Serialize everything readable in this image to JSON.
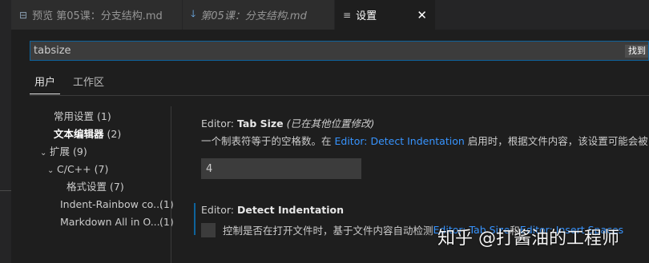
{
  "tabs": [
    {
      "label": "预览 第05课：分支结构.md",
      "icon": "preview-icon"
    },
    {
      "label": "第05课：分支结构.md",
      "icon": "markdown-down-arrow-icon"
    },
    {
      "label": "设置",
      "icon": "settings-lines-icon",
      "close": "✕"
    }
  ],
  "search": {
    "value": "tabsize",
    "badge": "找到"
  },
  "scopes": [
    {
      "label": "用户",
      "active": true
    },
    {
      "label": "工作区",
      "active": false
    }
  ],
  "toc": [
    {
      "label": "常用设置",
      "count": "(1)"
    },
    {
      "label": "文本编辑器",
      "count": "(2)"
    },
    {
      "label": "扩展",
      "count": "(9)"
    },
    {
      "label": "C/C++",
      "count": "(7)"
    },
    {
      "label": "格式设置",
      "count": "(7)"
    },
    {
      "label": "Indent-Rainbow co...",
      "count": "(1)"
    },
    {
      "label": "Markdown All in O...",
      "count": "(1)"
    }
  ],
  "settings": {
    "tab_size": {
      "category": "Editor: ",
      "name": "Tab Size",
      "modified_note": "(已在其他位置修改)",
      "desc_before": "一个制表符等于的空格数。在 ",
      "desc_link": "Editor: Detect Indentation",
      "desc_after": " 启用时，根据文件内容，该设置可能会被",
      "value": "4"
    },
    "detect_indentation": {
      "category": "Editor: ",
      "name": "Detect Indentation",
      "desc_before": "控制是否在打开文件时，基于文件内容自动检测 ",
      "desc_link1": "Editor: Tab Size",
      "desc_mid": " 和 ",
      "desc_link2": "Editor: Insert Spaces",
      "checked": false
    }
  },
  "watermark": "知乎 @打酱油的工程师"
}
